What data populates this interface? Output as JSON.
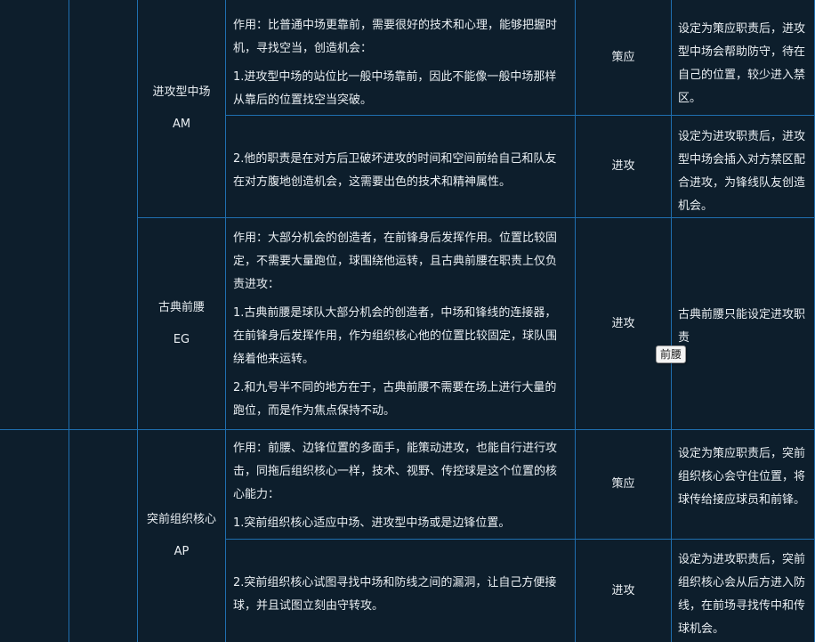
{
  "rows": [
    {
      "role_name": "进攻型中场",
      "role_code": "AM",
      "duties": [
        {
          "paragraphs": [
            "作用：比普通中场更靠前，需要很好的技术和心理，能够把握时机，寻找空当，创造机会：",
            "1.进攻型中场的站位比一般中场靠前，因此不能像一般中场那样从靠后的位置找空当突破。"
          ],
          "duty": "策应",
          "note": "设定为策应职责后，进攻型中场会帮助防守，待在自己的位置，较少进入禁区。"
        },
        {
          "paragraphs": [
            "2.他的职责是在对方后卫破坏进攻的时间和空间前给自己和队友在对方腹地创造机会，这需要出色的技术和精神属性。"
          ],
          "duty": "进攻",
          "note": "设定为进攻职责后，进攻型中场会插入对方禁区配合进攻，为锋线队友创造机会。"
        }
      ]
    },
    {
      "role_name": "古典前腰",
      "role_code": "EG",
      "duties": [
        {
          "paragraphs": [
            "作用：大部分机会的创造者，在前锋身后发挥作用。位置比较固定，不需要大量跑位，球围绕他运转，且古典前腰在职责上仅负责进攻：",
            "1.古典前腰是球队大部分机会的创造者，中场和锋线的连接器，在前锋身后发挥作用，作为组织核心他的位置比较固定，球队围绕着他来运转。",
            "2.和九号半不同的地方在于，古典前腰不需要在场上进行大量的跑位，而是作为焦点保持不动。"
          ],
          "duty": "进攻",
          "note": "古典前腰只能设定进攻职责"
        }
      ]
    },
    {
      "role_name": "突前组织核心",
      "role_code": "AP",
      "duties": [
        {
          "paragraphs": [
            "作用：前腰、边锋位置的多面手，能策动进攻，也能自行进行攻击，同拖后组织核心一样，技术、视野、传控球是这个位置的核心能力：",
            "1.突前组织核心适应中场、进攻型中场或是边锋位置。"
          ],
          "duty": "策应",
          "note": "设定为策应职责后，突前组织核心会守住位置，将球传给接应球员和前锋。"
        },
        {
          "paragraphs": [
            "2.突前组织核心试图寻找中场和防线之间的漏洞，让自己方便接球，并且试图立刻由守转攻。"
          ],
          "duty": "进攻",
          "note": "设定为进攻职责后，突前组织核心会从后方进入防线，在前场寻找传中和传球机会。"
        }
      ]
    }
  ],
  "tooltip": "前腰",
  "colors": {
    "background": "#0d1e2c",
    "border": "#1f6fb0",
    "text": "#e9eef2"
  }
}
